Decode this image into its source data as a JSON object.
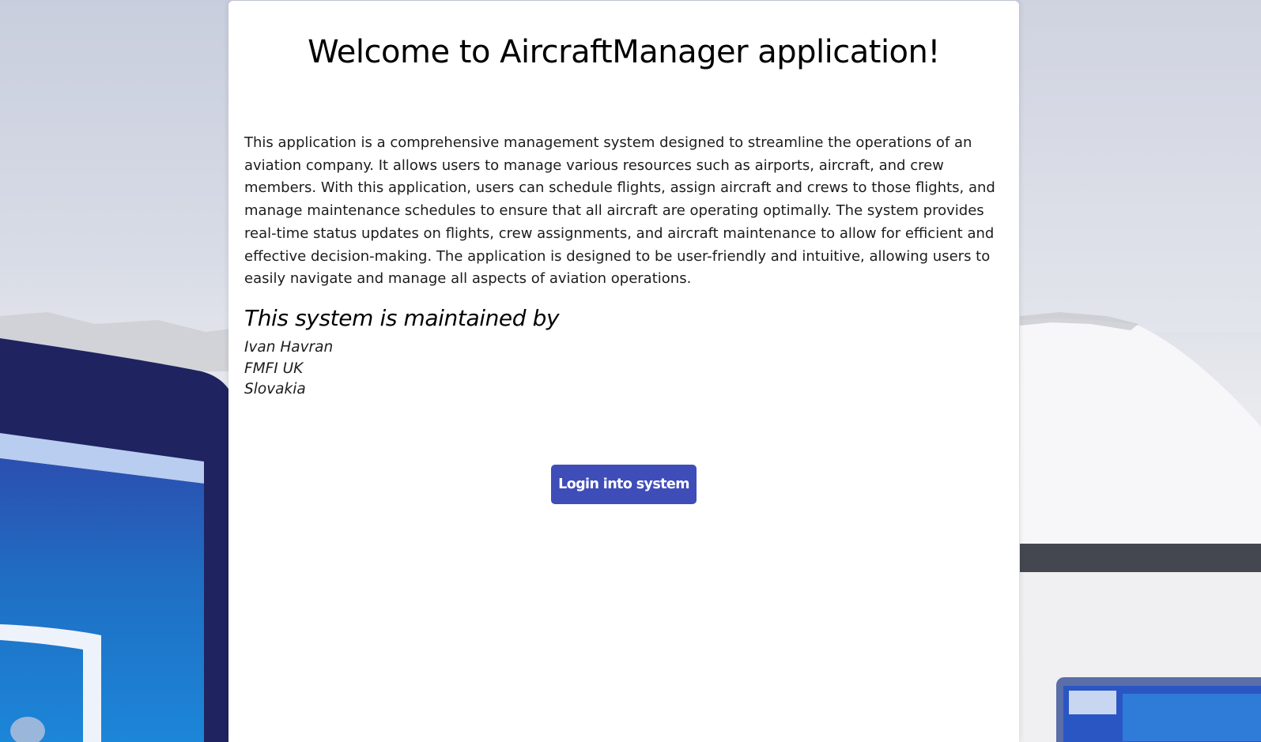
{
  "page": {
    "title": "Welcome to AircraftManager application!",
    "description": "This application is a comprehensive management system designed to streamline the operations of an aviation company. It allows users to manage various resources such as airports, aircraft, and crew members. With this application, users can schedule flights, assign aircraft and crews to those flights, and manage maintenance schedules to ensure that all aircraft are operating optimally. The system provides real-time status updates on flights, crew assignments, and aircraft maintenance to allow for efficient and effective decision-making. The application is designed to be user-friendly and intuitive, allowing users to easily navigate and manage all aspects of aviation operations.",
    "maintained_heading": "This system is maintained by",
    "maintainer": {
      "name": "Ivan Havran",
      "institution": "FMFI UK",
      "country": "Slovakia"
    },
    "login_button_label": "Login into system"
  },
  "colors": {
    "button_background": "#3f4db8",
    "card_background": "#ffffff",
    "illustration_dark_navy": "#1f2460",
    "illustration_blue": "#1e78c8"
  }
}
